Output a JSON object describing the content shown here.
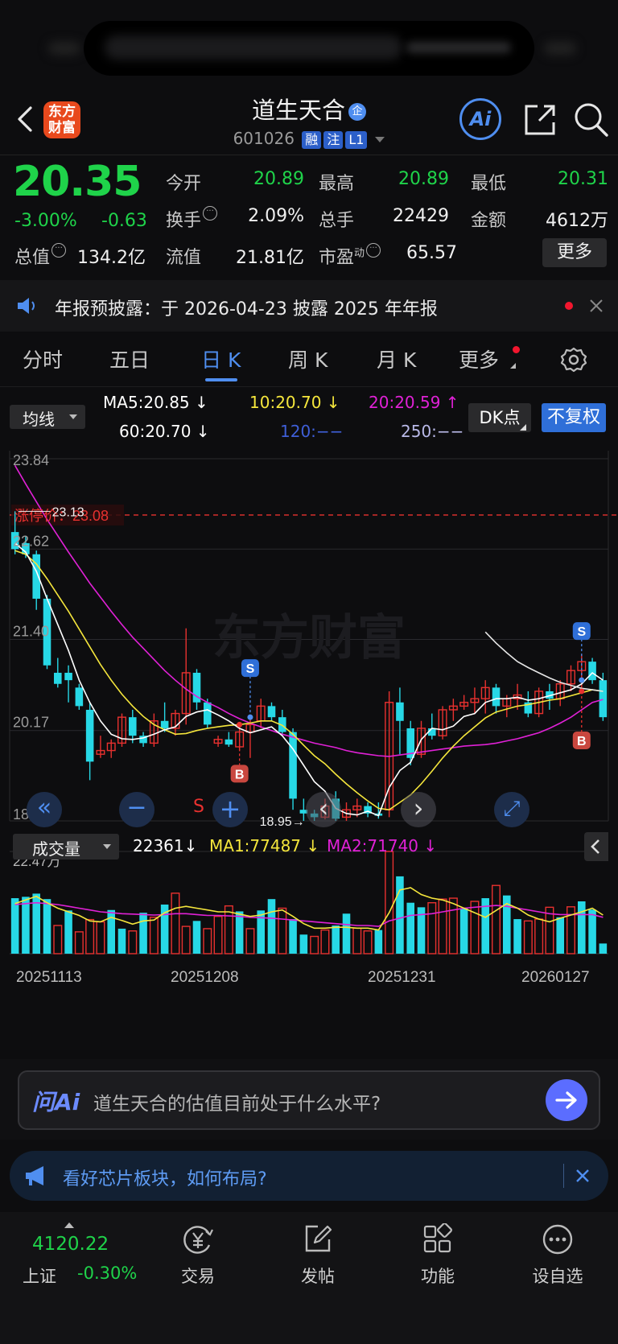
{
  "header": {
    "stock_name": "道生天合",
    "stock_badge": "企",
    "code": "601026",
    "tags": [
      "融",
      "注",
      "L1"
    ],
    "logo_line1": "东方",
    "logo_line2": "财富",
    "ai_label": "Ai"
  },
  "quote": {
    "price": "20.35",
    "change_pct": "-3.00%",
    "change_amt": "-0.63",
    "stats": {
      "open_label": "今开",
      "open": "20.89",
      "high_label": "最高",
      "high": "20.89",
      "low_label": "最低",
      "low": "20.31",
      "turnover_label": "换手",
      "turnover": "2.09%",
      "volume_label": "总手",
      "volume": "22429",
      "amount_label": "金额",
      "amount": "4612万",
      "mktcap_label": "总值",
      "mktcap": "134.2亿",
      "float_label": "流值",
      "float": "21.81亿",
      "pe_label": "市盈",
      "pe_sup": "动",
      "pe": "65.57"
    },
    "more_label": "更多"
  },
  "notice": {
    "text": "年报预披露：于 2026-04-23 披露 2025 年年报"
  },
  "period_tabs": {
    "items": [
      "分时",
      "五日",
      "日 K",
      "周 K",
      "月 K",
      "更多"
    ],
    "active": "日 K"
  },
  "ma_row": {
    "selector": "均线",
    "ma5": "MA5:20.85",
    "ma10": "10:20.70",
    "ma20": "20:20.59",
    "ma60": "60:20.70",
    "ma120": "120:−−",
    "ma250": "250:−−",
    "dk_label": "DK点",
    "fq_label": "不复权",
    "colors": {
      "ma5": "#ffffff",
      "ma10": "#f5e63c",
      "ma20": "#e021d6",
      "ma60": "#ffffff",
      "ma120": "#3f5fd8",
      "ma250": "#b9b9e8"
    }
  },
  "chart_data": [
    {
      "type": "candlestick",
      "y_ticks": [
        "23.84",
        "22.62",
        "21.40",
        "20.17",
        "18.95"
      ],
      "ylim": [
        18.95,
        23.84
      ],
      "limit_up_label": "涨停价：23.08",
      "limit_up": 23.08,
      "high_label": "23.13",
      "low_label": "18.95",
      "markers": [
        "B",
        "S",
        "B",
        "S"
      ],
      "colors": {
        "up": "#e8312f",
        "down": "#27d8e6",
        "ma5": "#ffffff",
        "ma10": "#f5e63c",
        "ma20": "#e021d6",
        "ma60": "#e6e6e6"
      },
      "candles": [
        [
          22.85,
          23.13,
          22.55,
          22.62
        ],
        [
          22.7,
          22.8,
          22.5,
          22.55
        ],
        [
          22.55,
          22.6,
          21.8,
          21.95
        ],
        [
          21.95,
          22.0,
          21.0,
          21.05
        ],
        [
          20.95,
          21.15,
          20.75,
          20.8
        ],
        [
          20.95,
          21.05,
          20.55,
          20.85
        ],
        [
          20.75,
          20.8,
          20.45,
          20.5
        ],
        [
          20.45,
          20.55,
          19.5,
          19.75
        ],
        [
          19.85,
          20.1,
          19.8,
          19.9
        ],
        [
          19.9,
          20.05,
          19.8,
          20.0
        ],
        [
          20.0,
          20.4,
          19.95,
          20.35
        ],
        [
          20.35,
          20.45,
          20.0,
          20.1
        ],
        [
          20.1,
          20.15,
          19.95,
          20.0
        ],
        [
          20.0,
          20.4,
          19.95,
          20.3
        ],
        [
          20.3,
          20.55,
          20.15,
          20.2
        ],
        [
          20.2,
          20.45,
          20.1,
          20.4
        ],
        [
          20.4,
          21.55,
          20.25,
          20.95
        ],
        [
          20.95,
          21.0,
          20.45,
          20.55
        ],
        [
          20.55,
          20.6,
          20.2,
          20.25
        ],
        [
          20.0,
          20.1,
          19.95,
          20.05
        ],
        [
          20.05,
          20.15,
          19.95,
          19.98
        ],
        [
          19.95,
          20.2,
          19.9,
          20.15
        ],
        [
          20.15,
          20.35,
          19.8,
          20.25
        ],
        [
          20.3,
          20.6,
          20.2,
          20.5
        ],
        [
          20.5,
          20.55,
          20.3,
          20.35
        ],
        [
          20.35,
          20.45,
          20.1,
          20.15
        ],
        [
          20.15,
          20.2,
          19.1,
          19.25
        ],
        [
          19.1,
          19.25,
          18.95,
          19.05
        ],
        [
          19.05,
          19.1,
          18.95,
          19.0
        ],
        [
          19.0,
          19.25,
          18.97,
          19.15
        ],
        [
          19.25,
          19.35,
          18.95,
          18.98
        ],
        [
          19.0,
          19.2,
          18.95,
          19.1
        ],
        [
          19.1,
          19.25,
          19.0,
          19.15
        ],
        [
          19.15,
          19.2,
          19.0,
          19.05
        ],
        [
          19.05,
          19.2,
          18.98,
          19.02
        ],
        [
          19.1,
          20.7,
          19.0,
          20.55
        ],
        [
          20.55,
          20.75,
          19.85,
          20.3
        ],
        [
          20.2,
          20.3,
          19.7,
          19.8
        ],
        [
          19.85,
          20.3,
          19.8,
          20.2
        ],
        [
          20.2,
          20.4,
          20.05,
          20.1
        ],
        [
          20.1,
          20.5,
          20.05,
          20.45
        ],
        [
          20.45,
          20.6,
          20.3,
          20.5
        ],
        [
          20.5,
          20.65,
          20.45,
          20.55
        ],
        [
          20.55,
          20.75,
          20.4,
          20.6
        ],
        [
          20.6,
          20.85,
          20.4,
          20.75
        ],
        [
          20.75,
          20.8,
          20.4,
          20.5
        ],
        [
          20.5,
          20.65,
          20.35,
          20.6
        ],
        [
          20.6,
          20.8,
          20.45,
          20.65
        ],
        [
          20.55,
          20.7,
          20.35,
          20.4
        ],
        [
          20.4,
          20.75,
          20.35,
          20.7
        ],
        [
          20.7,
          20.8,
          20.45,
          20.6
        ],
        [
          20.6,
          20.85,
          20.5,
          20.8
        ],
        [
          20.8,
          21.05,
          20.7,
          20.98
        ],
        [
          20.98,
          21.2,
          20.7,
          21.1
        ],
        [
          21.1,
          21.15,
          20.8,
          20.85
        ],
        [
          20.85,
          20.95,
          20.3,
          20.35
        ]
      ],
      "ma5": [
        22.7,
        22.58,
        22.32,
        21.95,
        21.6,
        21.25,
        20.85,
        20.55,
        20.3,
        20.12,
        20.06,
        20.05,
        20.07,
        20.12,
        20.18,
        20.22,
        20.36,
        20.42,
        20.45,
        20.38,
        20.3,
        20.2,
        20.14,
        20.18,
        20.22,
        20.1,
        19.92,
        19.7,
        19.48,
        19.35,
        19.12,
        19.05,
        19.03,
        19.08,
        19.02,
        19.4,
        19.63,
        19.74,
        20.05,
        20.2,
        20.18,
        20.23,
        20.36,
        20.4,
        20.55,
        20.6,
        20.6,
        20.62,
        20.58,
        20.6,
        20.64,
        20.68,
        20.72,
        20.8,
        20.95,
        20.85
      ],
      "ma10": [
        22.6,
        22.55,
        22.42,
        22.22,
        22.0,
        21.78,
        21.54,
        21.3,
        21.06,
        20.85,
        20.66,
        20.5,
        20.36,
        20.25,
        20.18,
        20.12,
        20.13,
        20.17,
        20.2,
        20.22,
        20.24,
        20.25,
        20.27,
        20.3,
        20.3,
        20.24,
        20.12,
        19.97,
        19.83,
        19.72,
        19.58,
        19.45,
        19.33,
        19.22,
        19.12,
        19.1,
        19.2,
        19.3,
        19.45,
        19.62,
        19.8,
        19.96,
        20.1,
        20.22,
        20.34,
        20.42,
        20.46,
        20.5,
        20.52,
        20.55,
        20.58,
        20.6,
        20.64,
        20.68,
        20.72,
        20.7
      ],
      "ma20": [
        23.75,
        23.5,
        23.26,
        23.02,
        22.8,
        22.58,
        22.37,
        22.16,
        21.97,
        21.78,
        21.6,
        21.43,
        21.28,
        21.13,
        20.98,
        20.85,
        20.73,
        20.63,
        20.55,
        20.48,
        20.4,
        20.33,
        20.27,
        20.22,
        20.17,
        20.12,
        20.08,
        20.04,
        20.0,
        19.97,
        19.94,
        19.9,
        19.87,
        19.85,
        19.83,
        19.82,
        19.84,
        19.86,
        19.88,
        19.9,
        19.92,
        19.94,
        19.96,
        19.97,
        19.98,
        20.0,
        20.03,
        20.06,
        20.1,
        20.14,
        20.2,
        20.27,
        20.35,
        20.45,
        20.55,
        20.59
      ],
      "ma60_start": 44,
      "ma60": [
        21.5,
        21.35,
        21.22,
        21.1,
        21.02,
        20.95,
        20.88,
        20.82,
        20.78,
        20.74,
        20.72,
        20.7
      ]
    },
    {
      "type": "bar",
      "title": "成交量",
      "current": "22361",
      "ma1_label": "MA1:77487",
      "ma2_label": "MA2:71740",
      "y_max_label": "22.47万",
      "ylim": [
        0,
        224700
      ],
      "x_labels": [
        "20251113",
        "20251208",
        "20251231",
        "20260127"
      ],
      "values": [
        122000,
        125000,
        132000,
        120000,
        62000,
        95000,
        48000,
        75000,
        70000,
        96000,
        55000,
        50000,
        90000,
        80000,
        108000,
        133000,
        60000,
        72000,
        55000,
        82000,
        105000,
        93000,
        55000,
        95000,
        120000,
        100000,
        76000,
        42000,
        38000,
        52000,
        62000,
        88000,
        56000,
        50000,
        52000,
        224700,
        170000,
        112000,
        102000,
        112000,
        120000,
        122000,
        100000,
        115000,
        122000,
        150000,
        128000,
        76000,
        72000,
        76000,
        102000,
        80000,
        103000,
        115000,
        97000,
        22361
      ],
      "up": [
        0,
        0,
        0,
        0,
        1,
        0,
        1,
        1,
        1,
        0,
        0,
        1,
        0,
        1,
        0,
        1,
        1,
        0,
        1,
        1,
        1,
        0,
        1,
        0,
        0,
        1,
        0,
        0,
        1,
        1,
        0,
        0,
        1,
        1,
        0,
        1,
        0,
        0,
        0,
        1,
        1,
        1,
        0,
        1,
        0,
        1,
        0,
        0,
        1,
        1,
        1,
        0,
        1,
        0,
        0,
        0
      ],
      "ma1": [
        110000,
        118000,
        126000,
        112000,
        100000,
        92000,
        84000,
        72000,
        70000,
        80000,
        73000,
        65000,
        72000,
        74000,
        90000,
        100000,
        104000,
        100000,
        96000,
        92000,
        92000,
        87000,
        82000,
        85000,
        92000,
        96000,
        82000,
        66000,
        56000,
        56000,
        58000,
        58000,
        56000,
        56000,
        52000,
        90000,
        140000,
        145000,
        130000,
        122000,
        118000,
        110000,
        100000,
        90000,
        80000,
        95000,
        110000,
        100000,
        85000,
        76000,
        70000,
        78000,
        85000,
        92000,
        100000,
        85000
      ],
      "ma2": [
        108000,
        110000,
        112000,
        110000,
        108000,
        104000,
        100000,
        96000,
        92000,
        90000,
        88000,
        87000,
        86000,
        85000,
        86000,
        88000,
        88000,
        86000,
        84000,
        84000,
        83000,
        82000,
        80000,
        79000,
        78000,
        76000,
        74000,
        72000,
        70000,
        68000,
        66000,
        64000,
        62000,
        62000,
        60000,
        72000,
        78000,
        84000,
        86000,
        88000,
        92000,
        96000,
        100000,
        102000,
        104000,
        106000,
        104000,
        100000,
        96000,
        92000,
        88000,
        86000,
        86000,
        86000,
        86000,
        80000
      ]
    }
  ],
  "chart_nav": {
    "first": "«",
    "zoom_out": "−",
    "s_label": "S",
    "zoom_in": "+",
    "prev": "‹",
    "next": "›",
    "expand": "⤢"
  },
  "ask_ai": {
    "logo": "问Ai",
    "placeholder": "道生天合的估值目前处于什么水平?"
  },
  "banner": {
    "text": "看好芯片板块，如何布局?"
  },
  "bottom_nav": {
    "index_value": "4120.22",
    "index_name": "上证",
    "index_change": "-0.30%",
    "items": [
      "交易",
      "发帖",
      "功能",
      "设自选"
    ]
  }
}
